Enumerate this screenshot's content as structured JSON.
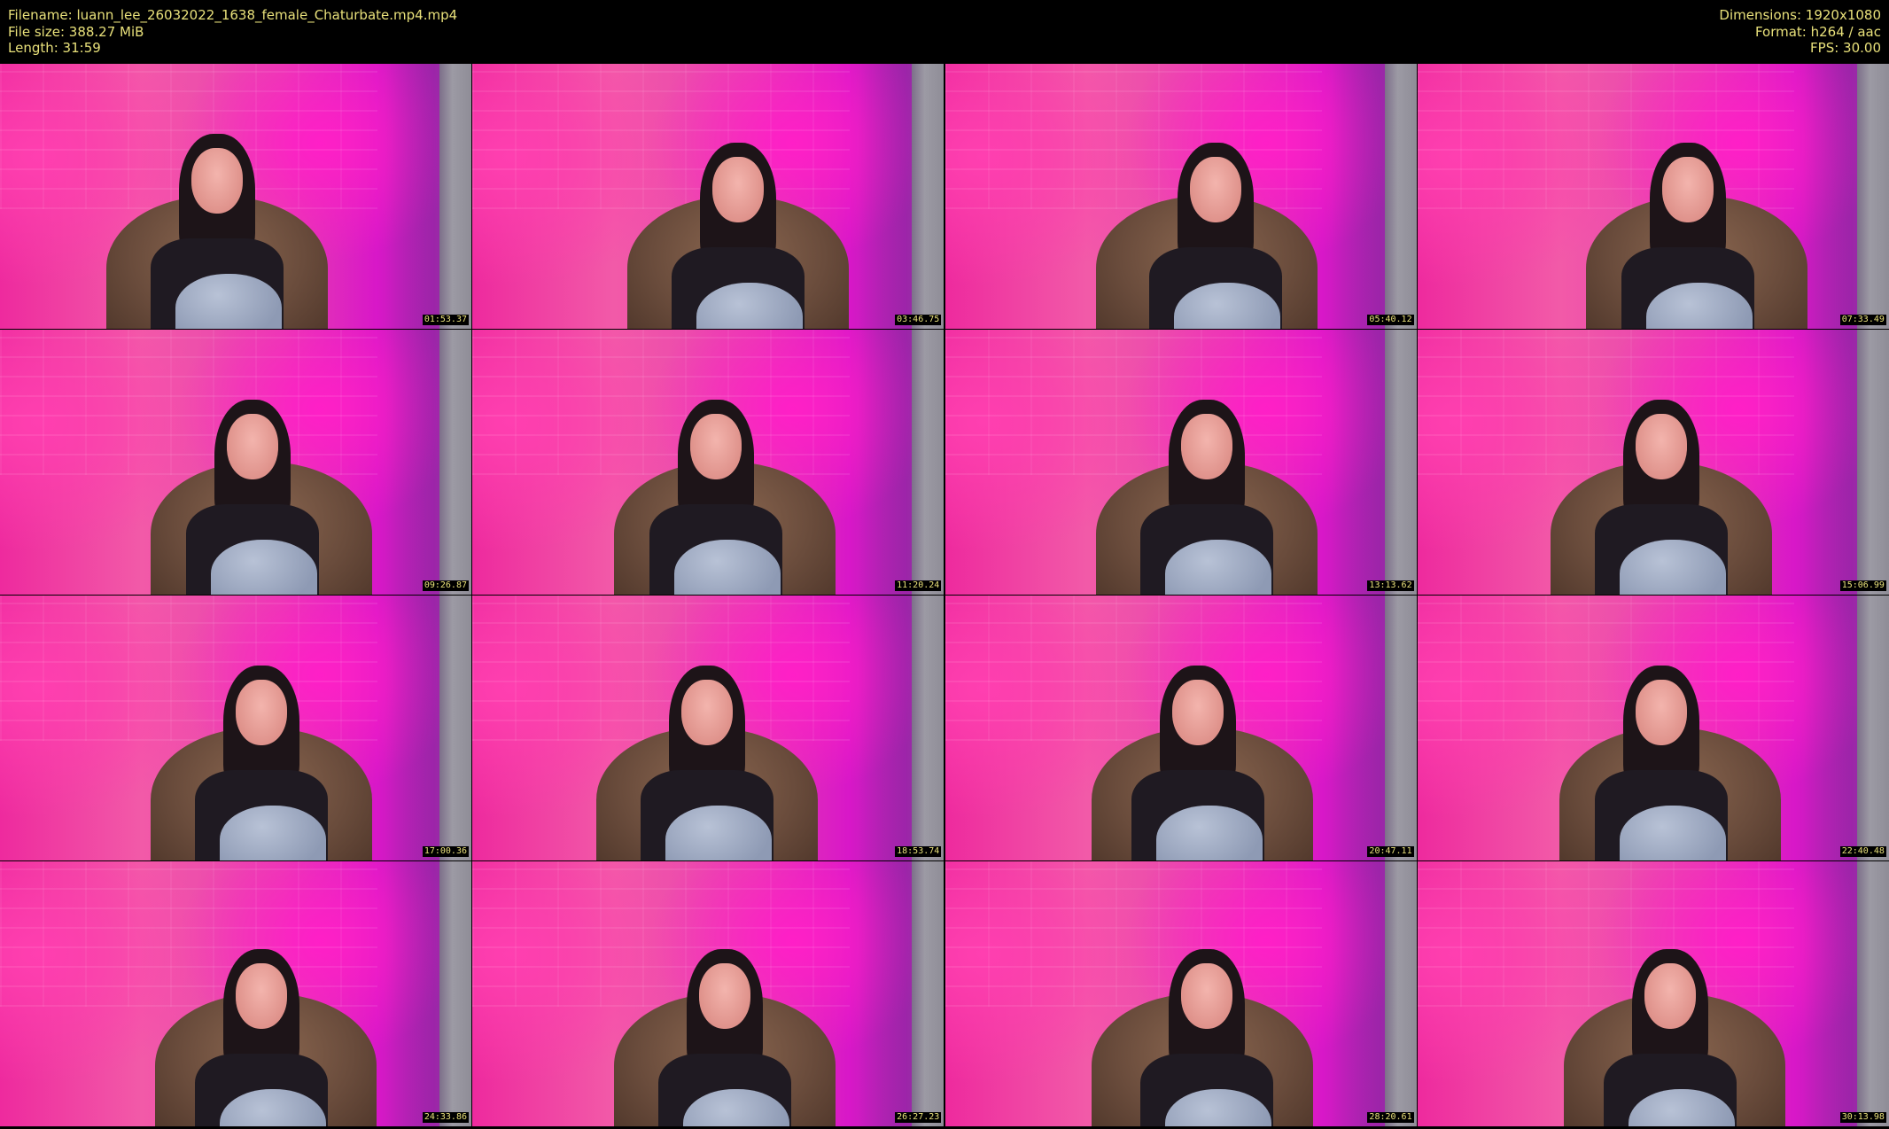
{
  "meta": {
    "filename": "Filename: luann_lee_26032022_1638_female_Chaturbate.mp4.mp4",
    "filesize": "File size: 388.27 MiB",
    "length": "Length: 31:59",
    "dimensions": "Dimensions: 1920x1080",
    "format": "Format: h264 / aac",
    "fps": "FPS: 30.00"
  },
  "thumbnails": [
    {
      "timestamp": "01:53.37"
    },
    {
      "timestamp": "03:46.75"
    },
    {
      "timestamp": "05:40.12"
    },
    {
      "timestamp": "07:33.49"
    },
    {
      "timestamp": "09:26.87"
    },
    {
      "timestamp": "11:20.24"
    },
    {
      "timestamp": "13:13.62"
    },
    {
      "timestamp": "15:06.99"
    },
    {
      "timestamp": "17:00.36"
    },
    {
      "timestamp": "18:53.74"
    },
    {
      "timestamp": "20:47.11"
    },
    {
      "timestamp": "22:40.48"
    },
    {
      "timestamp": "24:33.86"
    },
    {
      "timestamp": "26:27.23"
    },
    {
      "timestamp": "28:20.61"
    },
    {
      "timestamp": "30:13.98"
    }
  ]
}
